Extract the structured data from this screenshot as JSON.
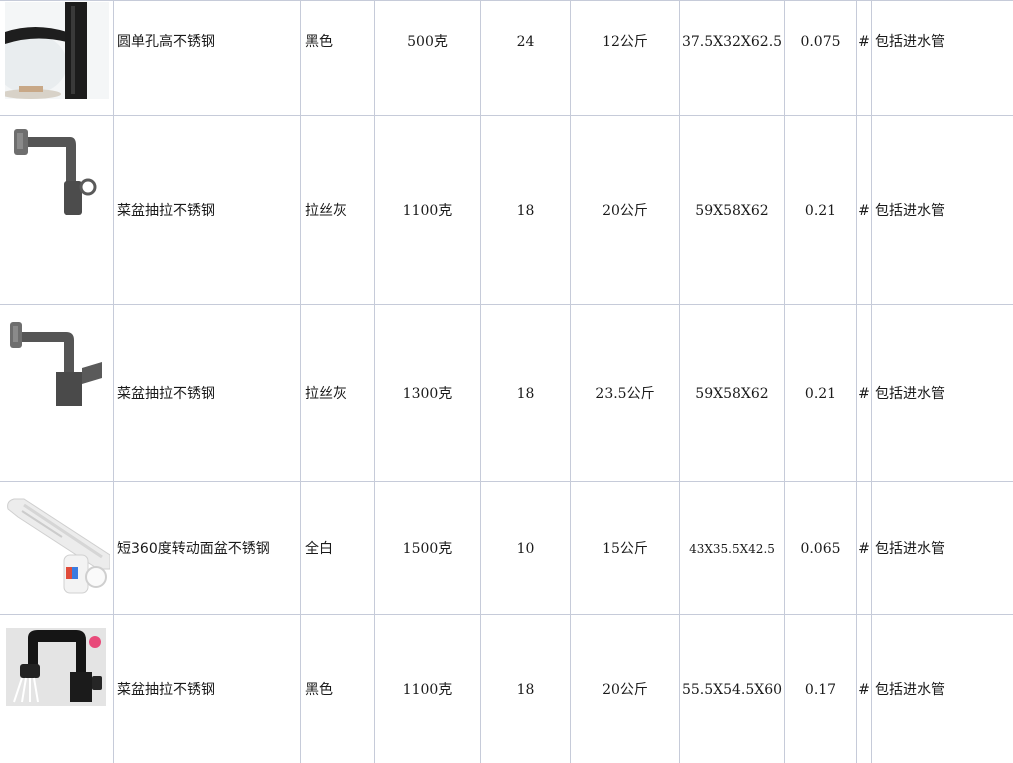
{
  "rows": [
    {
      "image": "black-basin-faucet",
      "name": "圆单孔高不锈钢",
      "color": "黑色",
      "weight": "500克",
      "qty": "24",
      "gross": "12公斤",
      "size": "37.5X32X62.5",
      "volume": "0.075",
      "mark": "#",
      "note": "包括进水管"
    },
    {
      "image": "gunmetal-pullout-faucet",
      "name": "菜盆抽拉不锈钢",
      "color": "拉丝灰",
      "weight": "1100克",
      "qty": "18",
      "gross": "20公斤",
      "size": "59X58X62",
      "volume": "0.21",
      "mark": "#",
      "note": "包括进水管"
    },
    {
      "image": "gunmetal-square-faucet",
      "name": "菜盆抽拉不锈钢",
      "color": "拉丝灰",
      "weight": "1300克",
      "qty": "18",
      "gross": "23.5公斤",
      "size": "59X58X62",
      "volume": "0.21",
      "mark": "#",
      "note": "包括进水管"
    },
    {
      "image": "white-rotating-faucet",
      "name": "短360度转动面盆不锈钢",
      "color": "全白",
      "weight": "1500克",
      "qty": "10",
      "gross": "15公斤",
      "size": "43X35.5X42.5",
      "volume": "0.065",
      "mark": "#",
      "note": "包括进水管"
    },
    {
      "image": "black-kitchen-faucet",
      "name": "菜盆抽拉不锈钢",
      "color": "黑色",
      "weight": "1100克",
      "qty": "18",
      "gross": "20公斤",
      "size": "55.5X54.5X60",
      "volume": "0.17",
      "mark": "#",
      "note": "包括进水管"
    }
  ]
}
